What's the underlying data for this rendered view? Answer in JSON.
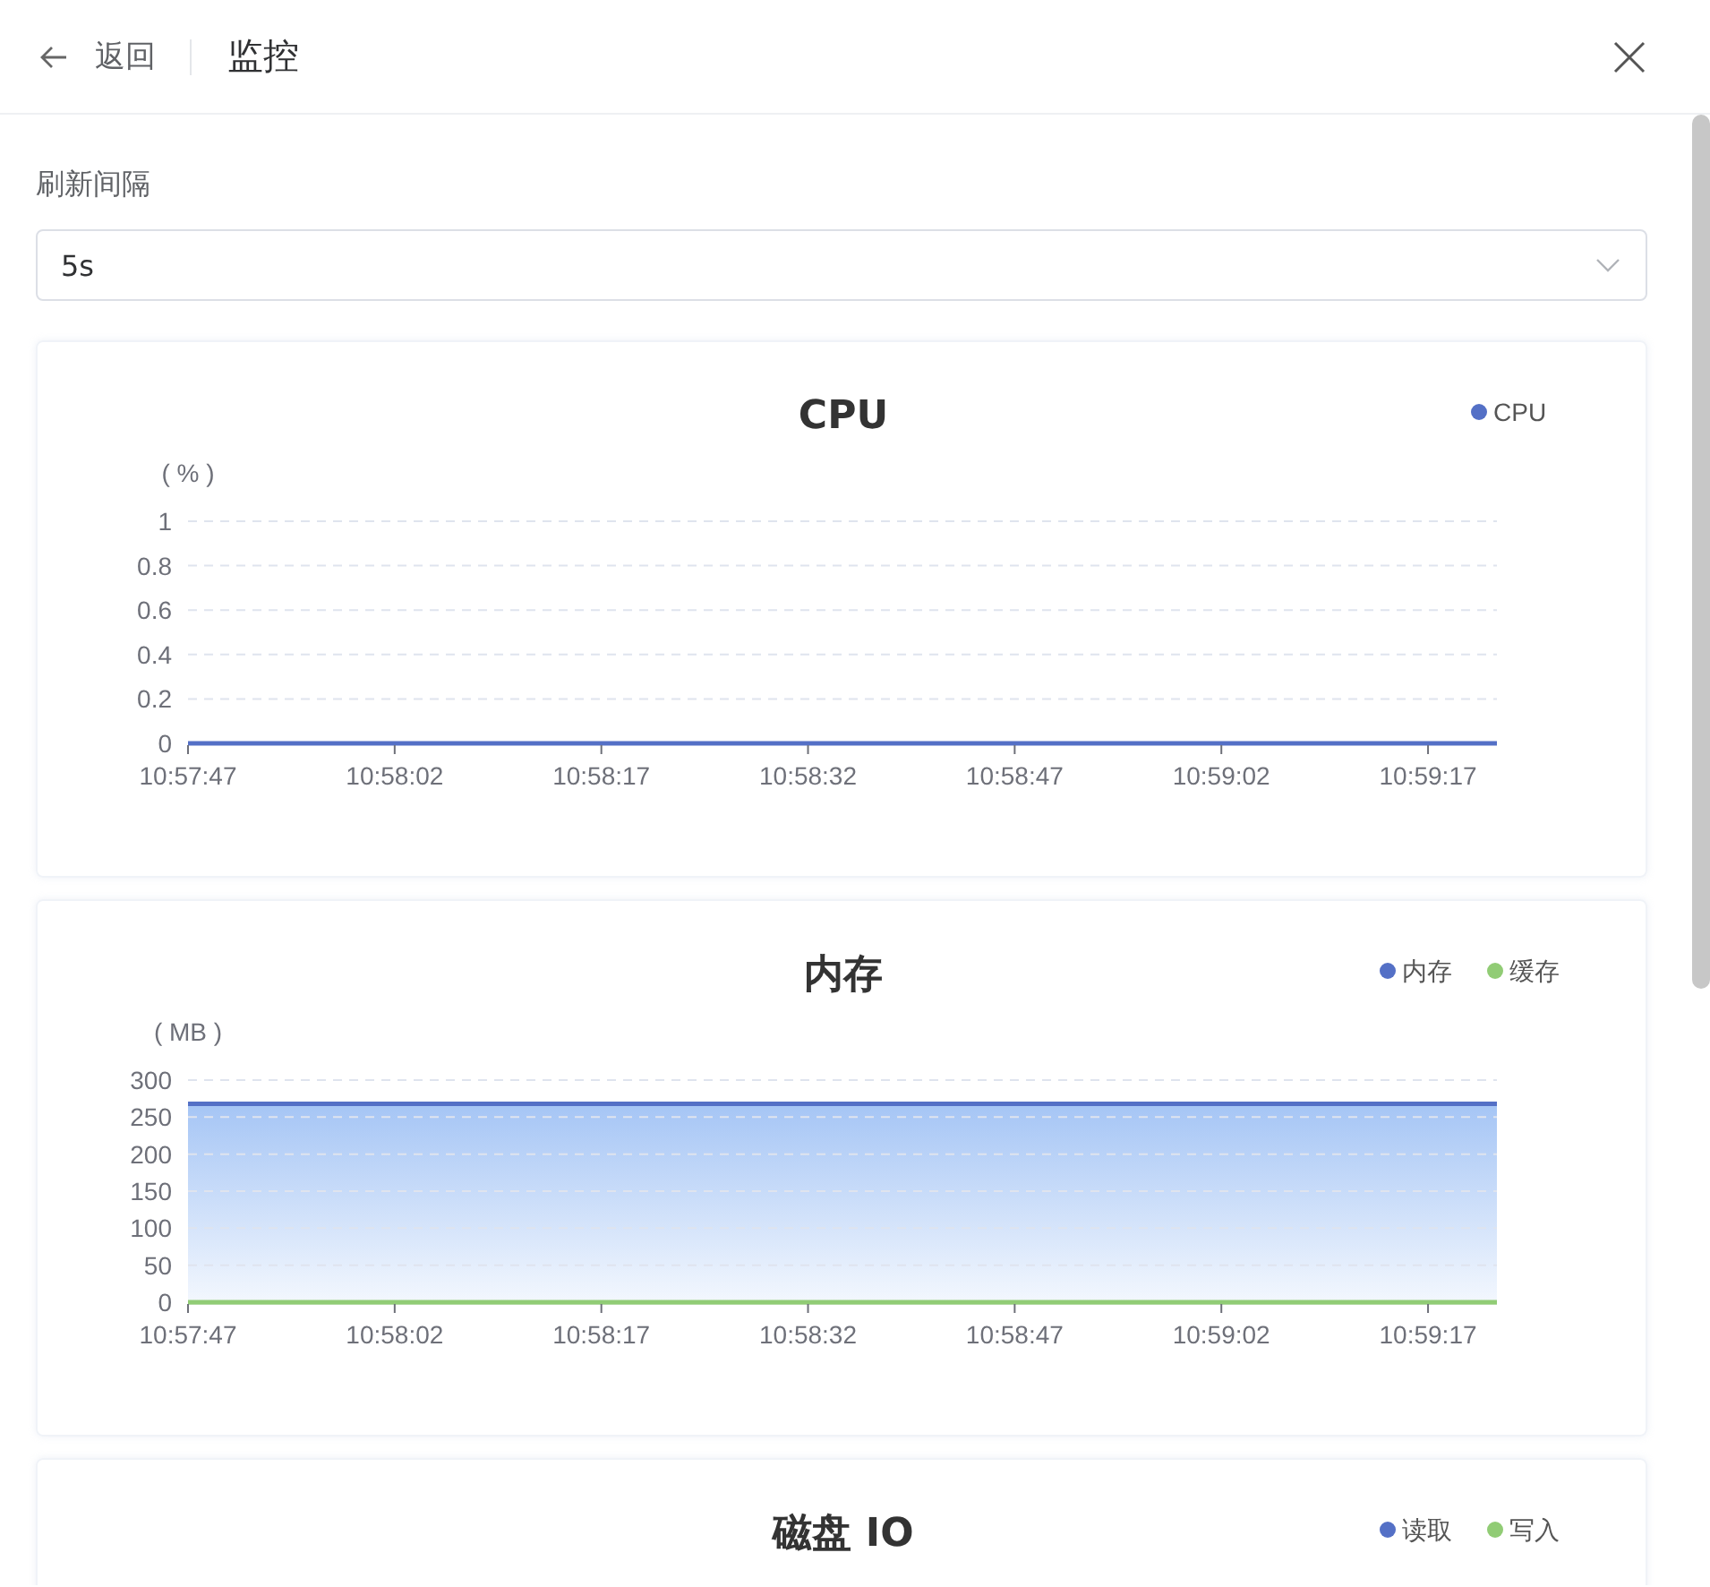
{
  "header": {
    "back_label": "返回",
    "title": "监控"
  },
  "refresh": {
    "label": "刷新间隔",
    "value": "5s"
  },
  "charts": [
    {
      "chart_data": {
        "type": "line",
        "title": "CPU",
        "ylabel": "( % )",
        "grid": true,
        "legend": "top-right",
        "categories": [
          "10:57:47",
          null,
          null,
          "10:58:02",
          null,
          null,
          "10:58:17",
          null,
          null,
          "10:58:32",
          null,
          null,
          "10:58:47",
          null,
          null,
          "10:59:02",
          null,
          null,
          "10:59:17",
          null
        ],
        "ylim": [
          0,
          1
        ],
        "yticks": [
          0,
          0.2,
          0.4,
          0.6,
          0.8,
          1
        ],
        "series": [
          {
            "name": "CPU",
            "color": "#5470c6",
            "values": [
              0,
              0,
              0,
              0,
              0,
              0,
              0,
              0,
              0,
              0,
              0,
              0,
              0,
              0,
              0,
              0,
              0,
              0,
              0,
              0
            ]
          }
        ]
      }
    },
    {
      "chart_data": {
        "type": "area",
        "title": "内存",
        "ylabel": "( MB )",
        "grid": true,
        "legend": "top-right",
        "categories": [
          "10:57:47",
          null,
          null,
          "10:58:02",
          null,
          null,
          "10:58:17",
          null,
          null,
          "10:58:32",
          null,
          null,
          "10:58:47",
          null,
          null,
          "10:59:02",
          null,
          null,
          "10:59:17",
          null
        ],
        "ylim": [
          0,
          300
        ],
        "yticks": [
          0,
          50,
          100,
          150,
          200,
          250,
          300
        ],
        "series": [
          {
            "name": "内存",
            "color": "#5470c6",
            "values": [
              268,
              268,
              268,
              268,
              268,
              268,
              268,
              268,
              268,
              268,
              268,
              268,
              268,
              268,
              268,
              268,
              268,
              268,
              268,
              268
            ]
          },
          {
            "name": "缓存",
            "color": "#91cc75",
            "values": [
              0,
              0,
              0,
              0,
              0,
              0,
              0,
              0,
              0,
              0,
              0,
              0,
              0,
              0,
              0,
              0,
              0,
              0,
              0,
              0
            ]
          }
        ]
      }
    },
    {
      "title": "磁盘 IO",
      "legend": [
        {
          "name": "读取",
          "color": "#5470c6"
        },
        {
          "name": "写入",
          "color": "#91cc75"
        }
      ]
    }
  ]
}
